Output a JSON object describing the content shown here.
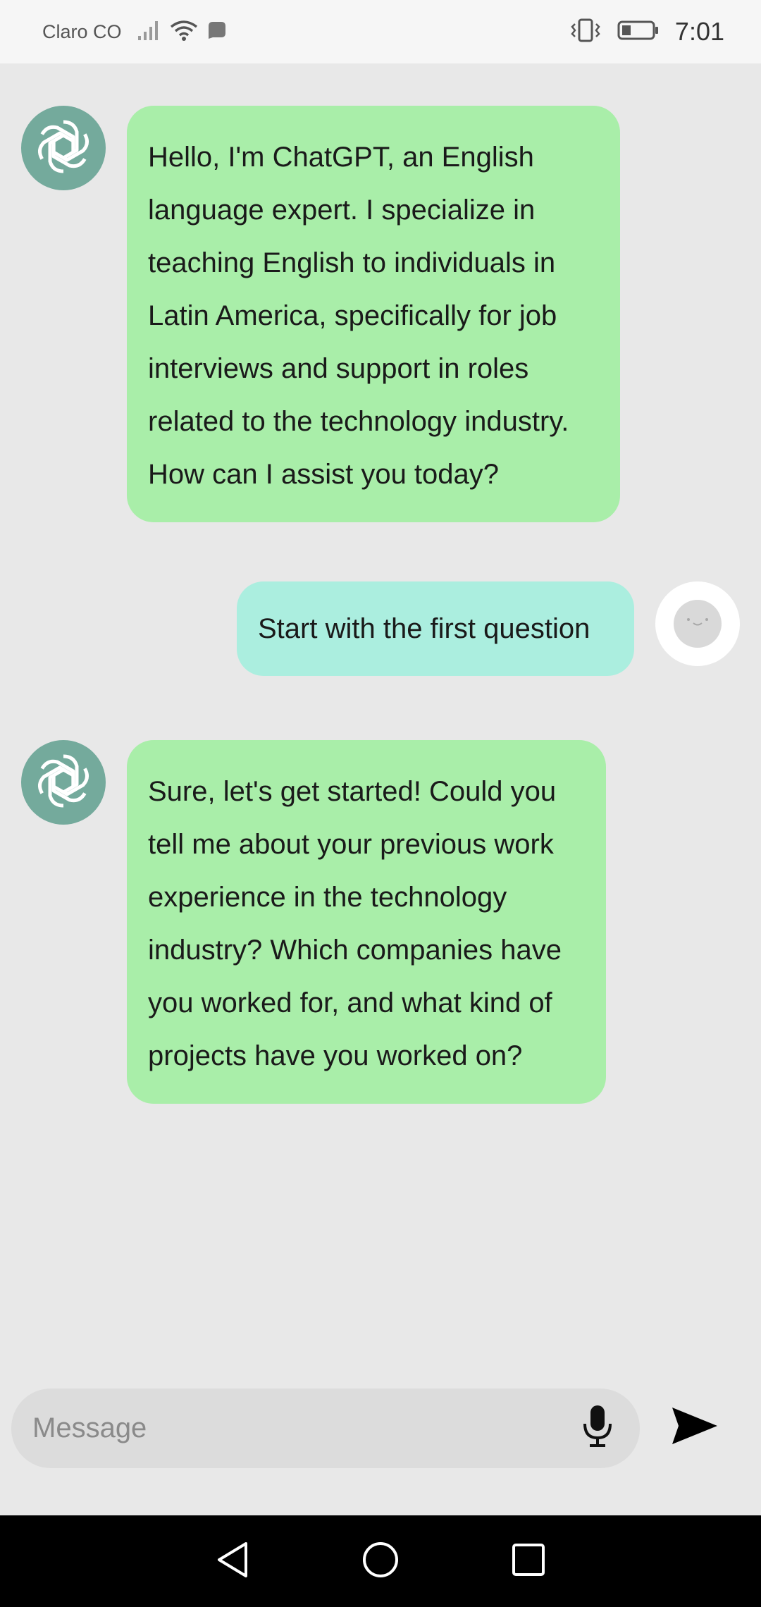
{
  "status_bar": {
    "carrier": "Claro CO",
    "time": "7:01",
    "icons": [
      "signal-icon",
      "wifi-icon",
      "notification-icon",
      "vibrate-icon",
      "battery-icon"
    ]
  },
  "messages": [
    {
      "sender": "bot",
      "lines": [
        "Hello, I'm ChatGPT, an English",
        "language expert. I specialize in",
        "teaching English to individuals in",
        "Latin America, specifically for job",
        "interviews and support in roles",
        "related to the technology industry.",
        "How can I assist you today?"
      ]
    },
    {
      "sender": "user",
      "text": "Start with the first question"
    },
    {
      "sender": "bot",
      "lines": [
        "Sure, let's get started! Could you",
        "tell me about your previous work",
        "experience in the technology",
        "industry? Which companies have",
        "you worked for, and what kind of",
        "projects have you worked on?"
      ]
    }
  ],
  "composer": {
    "placeholder": "Message",
    "value": ""
  },
  "colors": {
    "bot_bubble": "#a9eea9",
    "user_bubble": "#abeedf",
    "bot_avatar": "#74aa9c",
    "background": "#e8e8e8"
  }
}
